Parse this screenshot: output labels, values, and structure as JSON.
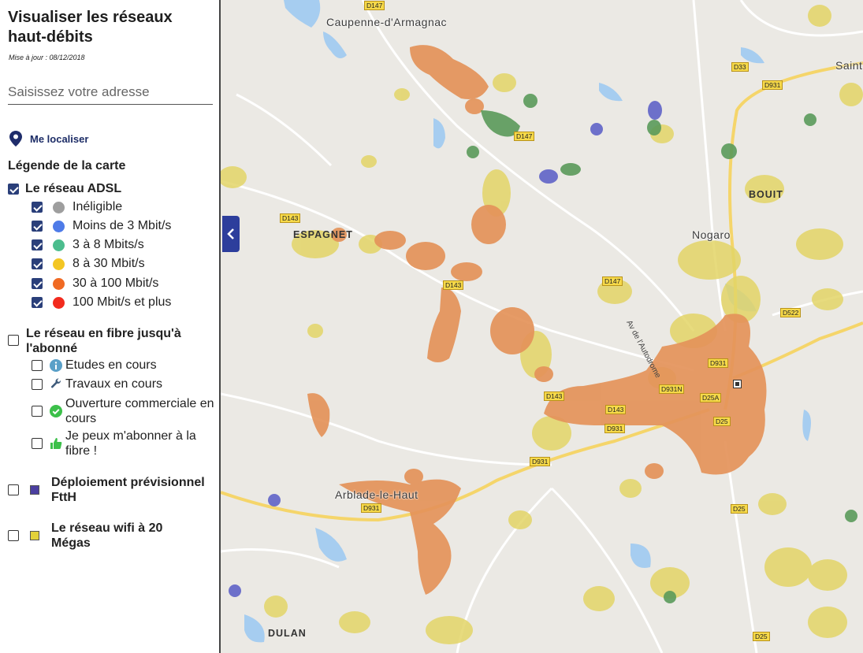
{
  "sidebar": {
    "title": "Visualiser les réseaux haut-débits",
    "updated": "Mise à jour : 08/12/2018",
    "search_placeholder": "Saisissez votre adresse",
    "locate_label": "Me localiser",
    "legend_title": "Légende de la carte",
    "adsl": {
      "label": "Le réseau ADSL",
      "checked": true,
      "items": [
        {
          "label": "Inéligible",
          "color": "#9e9e9e",
          "checked": true
        },
        {
          "label": "Moins de 3 Mbit/s",
          "color": "#4e7be8",
          "checked": true
        },
        {
          "label": "3 à 8 Mbits/s",
          "color": "#4cbd8e",
          "checked": true
        },
        {
          "label": "8 à 30 Mbit/s",
          "color": "#f3c623",
          "checked": true
        },
        {
          "label": "30 à 100 Mbit/s",
          "color": "#f06a23",
          "checked": true
        },
        {
          "label": "100 Mbit/s et plus",
          "color": "#f22b1e",
          "checked": true
        }
      ]
    },
    "fiber": {
      "label": "Le réseau en fibre jusqu'à l'abonné",
      "checked": false,
      "items": [
        {
          "label": "Etudes en cours",
          "icon": "info-icon",
          "checked": false
        },
        {
          "label": "Travaux en cours",
          "icon": "wrench-icon",
          "checked": false
        },
        {
          "label": "Ouverture commerciale en cours",
          "icon": "check-circle-icon",
          "checked": false
        },
        {
          "label": "Je peux m'abonner à la fibre !",
          "icon": "thumbs-up-icon",
          "checked": false
        }
      ]
    },
    "ftth": {
      "label": "Déploiement prévisionnel FttH",
      "color": "#4b3fa0",
      "checked": false
    },
    "wifi": {
      "label": "Le réseau wifi à 20 Mégas",
      "color": "#e3d13b",
      "checked": false
    }
  },
  "map": {
    "places": [
      "Caupenne-d'Armagnac",
      "ESPAGNET",
      "Nogaro",
      "BOUIT",
      "Arblade-le-Haut",
      "DULAN",
      "Saint"
    ],
    "roads": [
      "D147",
      "D33",
      "D931",
      "D143",
      "D522",
      "D931N",
      "D25A",
      "D25"
    ],
    "street": "Av de l'Autodrome",
    "colors": {
      "coverage_orange": "#e4935a",
      "coverage_yellow": "#e3d567",
      "coverage_green": "#5a9a5a",
      "coverage_purple": "#6064c8",
      "water": "#a6cdf0",
      "road_major": "#f5d56a",
      "background": "#ebe9e4"
    }
  }
}
